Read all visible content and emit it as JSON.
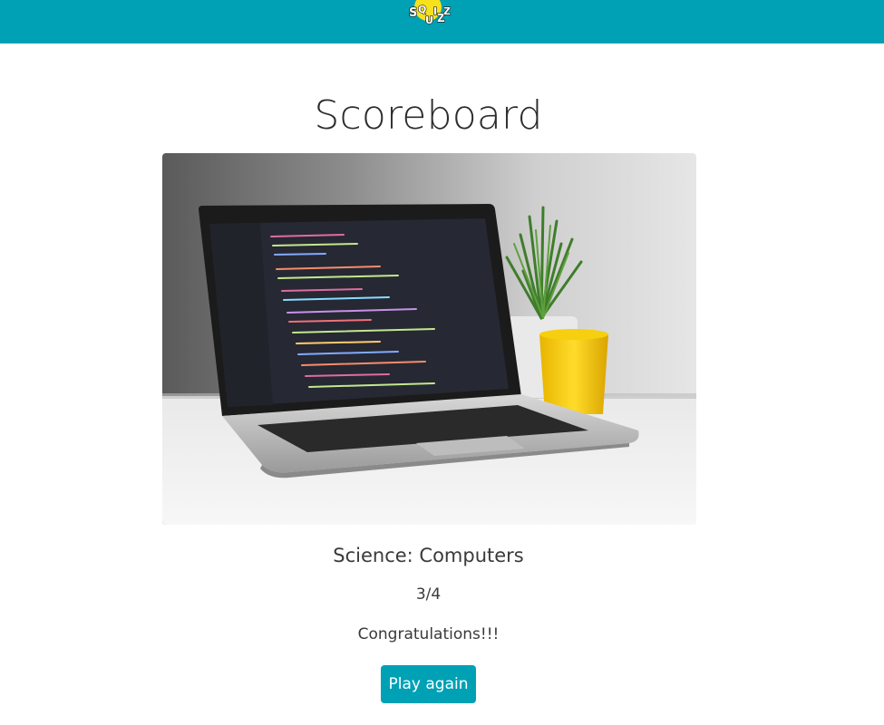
{
  "header": {
    "logo_text": "SQUIZZ",
    "brand_color": "#00a1b5"
  },
  "page": {
    "title": "Scoreboard"
  },
  "result": {
    "category": "Science: Computers",
    "score": "3/4",
    "message": "Congratulations!!!",
    "play_again_label": "Play again"
  },
  "image": {
    "alt": "Laptop with code on screen, potted plant and yellow mug"
  }
}
